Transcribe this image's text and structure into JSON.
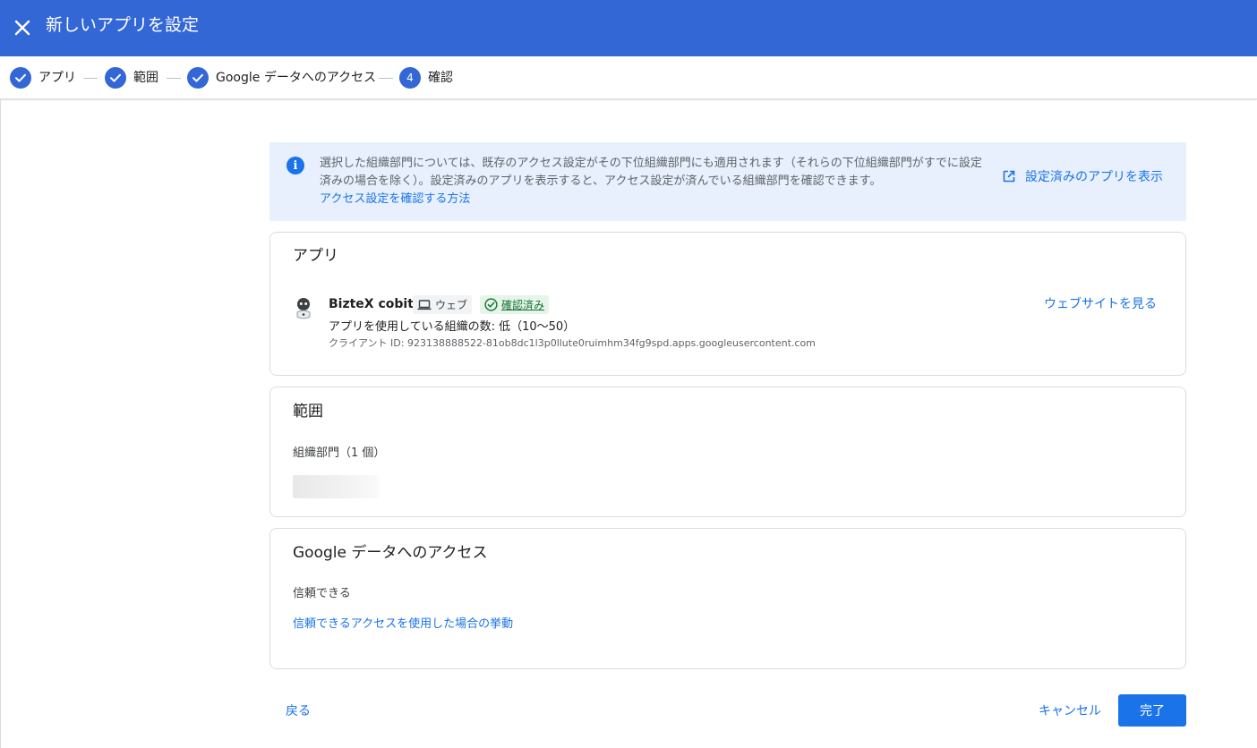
{
  "header": {
    "title": "新しいアプリを設定",
    "close_icon": "close-icon"
  },
  "stepper": {
    "steps": [
      {
        "label": "アプリ",
        "state": "completed"
      },
      {
        "label": "範囲",
        "state": "completed"
      },
      {
        "label": "Google データへのアクセス",
        "state": "completed"
      },
      {
        "label": "確認",
        "state": "current",
        "number": "4"
      }
    ]
  },
  "banner": {
    "text": "選択した組織部門については、既存のアクセス設定がその下位組織部門にも適用されます（それらの下位組織部門がすでに設定済みの場合を除く）。設定済みのアプリを表示すると、アクセス設定が済んでいる組織部門を確認できます。",
    "link": "アクセス設定を確認する方法",
    "action": "設定済みのアプリを表示"
  },
  "app_card": {
    "title": "アプリ",
    "app_name": "BizteX cobit",
    "platform_chip": "ウェブ",
    "verified_chip": "確認済み",
    "usage": "アプリを使用している組織の数: 低（10〜50）",
    "client_id": "クライアント ID: 923138888522-81ob8dc1l3p0llute0ruimhm34fg9spd.apps.googleusercontent.com",
    "website_link": "ウェブサイトを見る"
  },
  "scope_card": {
    "title": "範囲",
    "ou_label": "組織部門（1 個）"
  },
  "access_card": {
    "title": "Google データへのアクセス",
    "level": "信頼できる",
    "link": "信頼できるアクセスを使用した場合の挙動"
  },
  "footer": {
    "back": "戻る",
    "cancel": "キャンセル",
    "done": "完了"
  },
  "colors": {
    "header_bg": "#3367d6",
    "accent": "#1a73e8",
    "banner_bg": "#e8f0fe",
    "verified_bg": "#e6f4ea",
    "verified_text": "#137333"
  }
}
